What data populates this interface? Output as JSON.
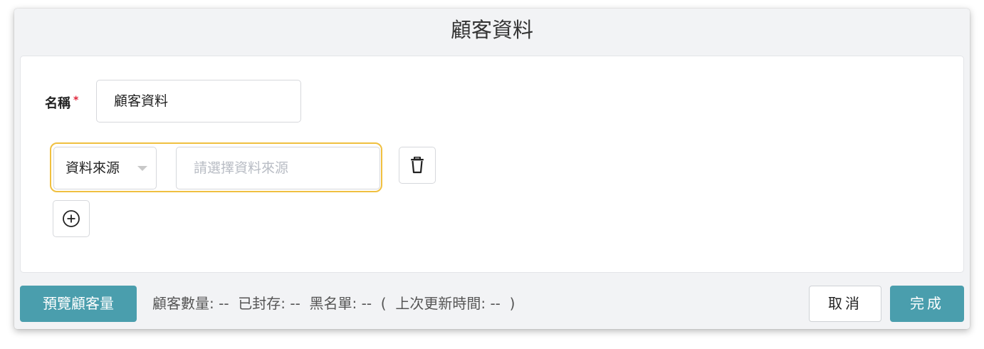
{
  "dialog": {
    "title": "顧客資料",
    "name_label": "名稱",
    "required_mark": "*",
    "name_value": "顧客資料",
    "source_select_value": "資料來源",
    "source_placeholder": "請選擇資料來源",
    "delete_icon": "trash-icon",
    "add_icon": "plus-circle-icon"
  },
  "footer": {
    "preview_label": "預覽顧客量",
    "customer_count_label": "顧客數量:",
    "customer_count_value": "--",
    "archived_label": "已封存:",
    "archived_value": "--",
    "blacklist_label": "黑名單:",
    "blacklist_value": "--",
    "open_paren": "(",
    "last_update_label": "上次更新時間:",
    "last_update_value": "--",
    "close_paren": ")",
    "cancel_label": "取消",
    "done_label": "完成"
  },
  "colors": {
    "accent": "#4a9ead",
    "highlight_border": "#f0c040",
    "required": "#e0263b"
  }
}
